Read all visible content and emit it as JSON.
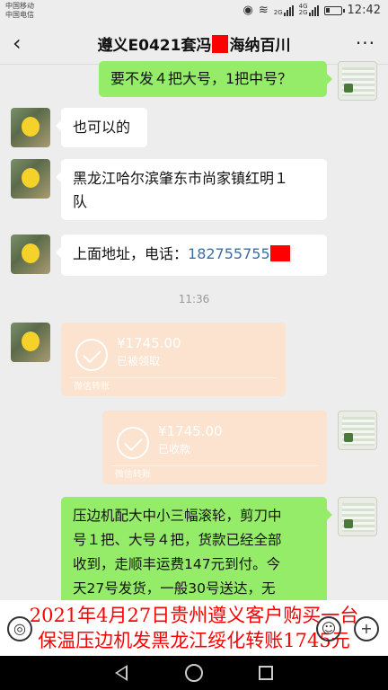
{
  "status_bar": {
    "carrier_1": "中国移动",
    "carrier_2": "中国电信",
    "sig_label_1": "2G",
    "sig_label_2": "4G",
    "sig_label_3": "2G",
    "time": "12:42"
  },
  "nav": {
    "back_icon": "chevron-left-icon",
    "title_prefix": "遵义E0421套冯",
    "title_suffix": "海纳百川",
    "more_icon": "more-dots-icon"
  },
  "messages": [
    {
      "side": "right",
      "text": "要不发４把大号，1把中号？"
    },
    {
      "side": "left",
      "text": "也可以的"
    },
    {
      "side": "left",
      "text_line1": "黑龙江哈尔滨肇东市尚家镇红明１",
      "text_line2": "队"
    },
    {
      "side": "left",
      "text_prefix": "上面地址，电话：",
      "phone": "182755755"
    }
  ],
  "timestamp": "11:36",
  "transfers": [
    {
      "side": "left",
      "amount": "¥1745.00",
      "status": "已被领取",
      "footer": "微信转账"
    },
    {
      "side": "right",
      "amount": "¥1745.00",
      "status": "已收款",
      "footer": "微信转账"
    }
  ],
  "last_message": {
    "side": "right",
    "lines": [
      "压边机配大中小三幅滚轮，剪刀中",
      "号１把、大号４把，货款已经全部",
      "收到，走顺丰运费147元到付。今",
      "天27号发货，一般30号送达，无"
    ]
  },
  "caption": {
    "line1": "2021年4月27日贵州遵义客户购买一台",
    "line2": "保温压边机发黑龙江绥化转账1745元"
  },
  "colors": {
    "bubble_green": "#95ec69",
    "transfer_orange": "#fbe3cf",
    "caption_red": "#ff0000",
    "background": "#ededed"
  }
}
